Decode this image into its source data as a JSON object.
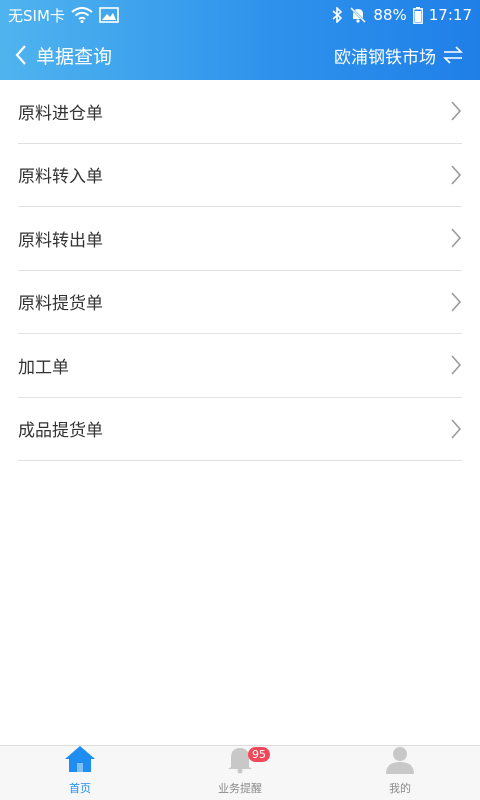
{
  "status_bar": {
    "carrier": "无SIM卡",
    "battery": "88%",
    "time": "17:17"
  },
  "navbar": {
    "title": "单据查询",
    "market": "欧浦钢铁市场"
  },
  "list": {
    "items": [
      {
        "label": "原料进仓单"
      },
      {
        "label": "原料转入单"
      },
      {
        "label": "原料转出单"
      },
      {
        "label": "原料提货单"
      },
      {
        "label": "加工单"
      },
      {
        "label": "成品提货单"
      }
    ]
  },
  "tabbar": {
    "tabs": [
      {
        "label": "首页",
        "icon": "home-icon"
      },
      {
        "label": "业务提醒",
        "icon": "bell-icon",
        "badge": "95"
      },
      {
        "label": "我的",
        "icon": "person-icon"
      }
    ]
  },
  "colors": {
    "header_start": "#4fb4ee",
    "header_end": "#1f7fe8",
    "active_tab": "#1f8ef0",
    "badge": "#f04a5a"
  }
}
